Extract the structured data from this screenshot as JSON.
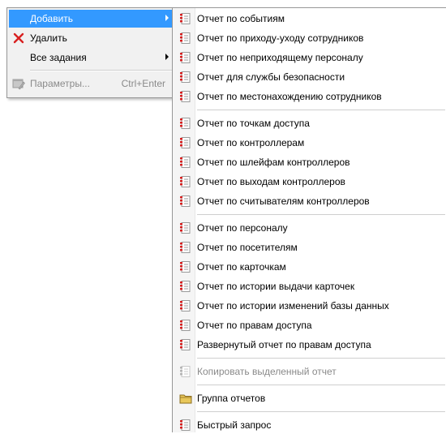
{
  "main_menu": {
    "add_label": "Добавить",
    "delete_label": "Удалить",
    "all_tasks_label": "Все задания",
    "params_label": "Параметры...",
    "params_shortcut": "Ctrl+Enter"
  },
  "submenu": {
    "groups": [
      {
        "items": [
          {
            "label": "Отчет по событиям",
            "icon": "report-icon"
          },
          {
            "label": "Отчет по приходу-уходу сотрудников",
            "icon": "report-icon"
          },
          {
            "label": "Отчет по неприходящему персоналу",
            "icon": "report-icon"
          },
          {
            "label": "Отчет для службы безопасности",
            "icon": "report-icon"
          },
          {
            "label": "Отчет по местонахождению сотрудников",
            "icon": "report-icon"
          }
        ]
      },
      {
        "items": [
          {
            "label": "Отчет по точкам доступа",
            "icon": "report-icon"
          },
          {
            "label": "Отчет по контроллерам",
            "icon": "report-icon"
          },
          {
            "label": "Отчет по шлейфам контроллеров",
            "icon": "report-icon"
          },
          {
            "label": "Отчет по выходам контроллеров",
            "icon": "report-icon"
          },
          {
            "label": "Отчет по считывателям контроллеров",
            "icon": "report-icon"
          }
        ]
      },
      {
        "items": [
          {
            "label": "Отчет по персоналу",
            "icon": "report-icon"
          },
          {
            "label": "Отчет по посетителям",
            "icon": "report-icon"
          },
          {
            "label": "Отчет по карточкам",
            "icon": "report-icon"
          },
          {
            "label": "Отчет по истории выдачи карточек",
            "icon": "report-icon"
          },
          {
            "label": "Отчет по истории изменений базы данных",
            "icon": "report-icon"
          },
          {
            "label": "Отчет по правам доступа",
            "icon": "report-icon"
          },
          {
            "label": "Развернутый отчет по правам доступа",
            "icon": "report-icon"
          }
        ]
      }
    ],
    "copy_selected_label": "Копировать выделенный отчет",
    "report_group_label": "Группа отчетов",
    "quick_query_label": "Быстрый запрос"
  },
  "colors": {
    "highlight": "#3399ff",
    "report_icon_red": "#d81e1e",
    "delete_icon_red": "#d82020",
    "folder_yellow": "#e8c75a"
  }
}
